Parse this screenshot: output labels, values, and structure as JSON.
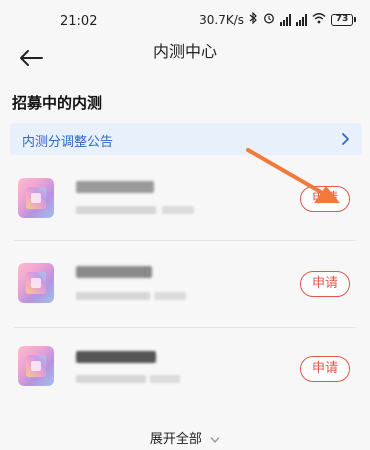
{
  "status_bar": {
    "time": "21:02",
    "network_speed": "30.7K/s",
    "battery": "73"
  },
  "header": {
    "title": "内测中心"
  },
  "section": {
    "title": "招募中的内测"
  },
  "notice": {
    "label": "内测分调整公告"
  },
  "items": [
    {
      "apply_label": "申请"
    },
    {
      "apply_label": "申请"
    },
    {
      "apply_label": "申请"
    }
  ],
  "footer": {
    "expand_label": "展开全部"
  },
  "colors": {
    "accent_red": "#e0584a",
    "notice_bg": "#e8f0fc",
    "notice_text": "#2f66c7",
    "annotation_arrow": "#f07a3c"
  }
}
